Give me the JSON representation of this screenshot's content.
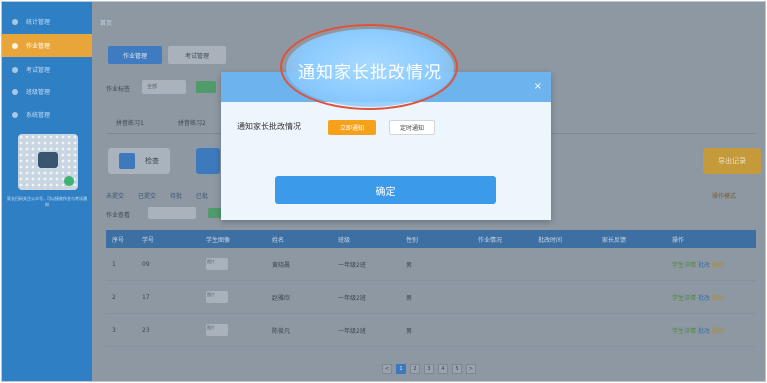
{
  "sidebar": {
    "items": [
      {
        "label": "统计管理"
      },
      {
        "label": "作业管理"
      },
      {
        "label": "考试管理"
      },
      {
        "label": "班级管理"
      },
      {
        "label": "系统管理"
      }
    ],
    "note": "家长扫码关注公众号，可以接收作业与考试通知"
  },
  "header": {
    "breadcrumb": "首页",
    "tab_primary": "作业管理",
    "tab_secondary": "考试管理"
  },
  "filters": {
    "label": "作业标签",
    "select_value": "全部"
  },
  "subtabs": [
    "拼音练习1",
    "拼音练习2"
  ],
  "toolbar": {
    "check_label": "检查",
    "export_label": "导出记录"
  },
  "status_row": [
    "未提交",
    "已提交",
    "待批",
    "已批"
  ],
  "right_link": "操作模式",
  "homework": {
    "label": "作业查看"
  },
  "table": {
    "headers": [
      "序号",
      "学号",
      "学生图像",
      "姓名",
      "班级",
      "性别",
      "作业情况",
      "批改时间",
      "家长反馈",
      "操作"
    ],
    "rows": [
      {
        "no": "1",
        "sid": "09",
        "img": "图片",
        "name": "黄晓晨",
        "class": "一年级2班",
        "sex": "男"
      },
      {
        "no": "2",
        "sid": "17",
        "img": "图片",
        "name": "赵雅欣",
        "class": "一年级2班",
        "sex": "男"
      },
      {
        "no": "3",
        "sid": "23",
        "img": "图片",
        "name": "陈俊凡",
        "class": "一年级2班",
        "sex": "男"
      }
    ],
    "action": {
      "detail": "学生详情",
      "edit": "批改",
      "del": "删除"
    }
  },
  "pager": [
    "<",
    "1",
    "2",
    "3",
    "4",
    "5",
    ">"
  ],
  "modal": {
    "title": "通知家长批改情况",
    "option_label": "通知家长批改情况",
    "btn_now": "立即通知",
    "btn_scheduled": "定时通知",
    "confirm": "确定",
    "close": "×"
  },
  "colors": {
    "accent": "#3b9ae9",
    "warning": "#f5a21a",
    "highlight_ring": "#e0523a"
  }
}
